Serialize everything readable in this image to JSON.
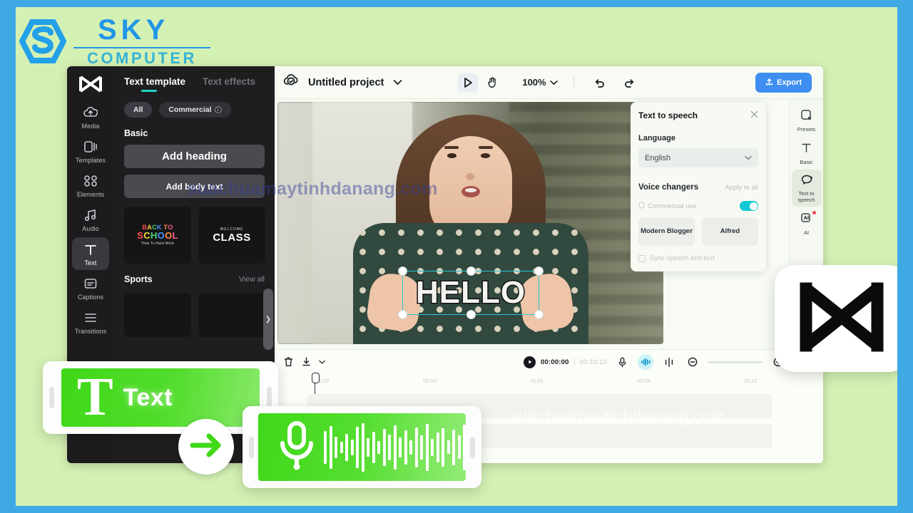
{
  "brand": {
    "name_top": "SKY",
    "name_bottom": "COMPUTER",
    "logo_icon": "sky-hexagon-s-logo"
  },
  "watermarks": {
    "top": "suachuamaytinhdanang.com",
    "timeline": "suachuamaytinhdanang.com"
  },
  "rail": {
    "app_logo_icon": "capcut-logo-icon",
    "items": [
      {
        "label": "Media",
        "icon": "cloud-upload-icon",
        "active": false
      },
      {
        "label": "Templates",
        "icon": "templates-icon",
        "active": false
      },
      {
        "label": "Elements",
        "icon": "elements-icon",
        "active": false
      },
      {
        "label": "Audio",
        "icon": "music-note-icon",
        "active": false
      },
      {
        "label": "Text",
        "icon": "text-t-icon",
        "active": true
      },
      {
        "label": "Captions",
        "icon": "captions-icon",
        "active": false
      },
      {
        "label": "Transitions",
        "icon": "transitions-icon",
        "active": false
      }
    ]
  },
  "panel": {
    "tabs": [
      {
        "label": "Text template",
        "active": true
      },
      {
        "label": "Text effects",
        "active": false
      }
    ],
    "chips": [
      {
        "label": "All",
        "selected": true,
        "info": false
      },
      {
        "label": "Commercial",
        "selected": false,
        "info": true,
        "info_glyph": "i"
      }
    ],
    "sections": [
      {
        "title": "Basic",
        "view_all": ""
      },
      {
        "title": "Sports",
        "view_all": "View all"
      }
    ],
    "buttons": [
      {
        "label": "Add heading"
      },
      {
        "label": "Add body text"
      }
    ],
    "thumbnails": [
      {
        "line1": "BACK TO",
        "line2": "SCHOOL",
        "line3": "Time To Hard Work"
      },
      {
        "small": "WELCOME",
        "big": "CLASS"
      }
    ],
    "scroll_arrow_icon": "chevron-right-icon"
  },
  "topbar": {
    "cloud_icon": "cloud-check-icon",
    "project_name": "Untitled project",
    "project_caret_icon": "chevron-down-icon",
    "tools": [
      {
        "icon": "select-arrow-icon",
        "active": true
      },
      {
        "icon": "hand-pan-icon",
        "active": false
      }
    ],
    "zoom_level": "100%",
    "zoom_caret_icon": "chevron-down-icon",
    "undo_icon": "undo-icon",
    "redo_icon": "redo-icon",
    "export_label": "Export",
    "export_icon": "export-upload-icon",
    "export_color": "#3d8ef0"
  },
  "canvas": {
    "overlay_text": "HELLO",
    "selection_handles": 6,
    "selection_color": "#27c4d2"
  },
  "tts": {
    "title": "Text to speech",
    "close_icon": "close-icon",
    "language_label": "Language",
    "language_value": "English",
    "language_caret_icon": "chevron-down-icon",
    "voice_changers_label": "Voice changers",
    "apply_to_all_label": "Apply to all",
    "commercial_use_label": "Commercial use",
    "commercial_use_icon": "shield-info-icon",
    "commercial_use_on": true,
    "toggle_color": "#13c9d6",
    "voices": [
      {
        "label": "Modern Blogger"
      },
      {
        "label": "Alfred"
      }
    ],
    "sync_label": "Sync speech and text",
    "sync_checked": false
  },
  "proprail": {
    "items": [
      {
        "label": "Presets",
        "icon": "presets-icon",
        "active": false,
        "badge": false
      },
      {
        "label": "Basic",
        "icon": "text-t-icon",
        "active": false,
        "badge": false
      },
      {
        "label": "Text to speech",
        "icon": "speech-bubble-icon",
        "active": true,
        "badge": false
      },
      {
        "label": "AI",
        "icon": "ai-sparkle-icon",
        "active": false,
        "badge": true
      }
    ]
  },
  "timeline": {
    "delete_icon": "trash-icon",
    "download_icon": "download-icon",
    "download_caret_icon": "chevron-down-icon",
    "play_icon": "play-icon",
    "current_time": "00:00:00",
    "total_time": "00:10:10",
    "right_tools": [
      {
        "icon": "microphone-icon",
        "highlighted": false
      },
      {
        "icon": "waveform-icon",
        "highlighted": true
      },
      {
        "icon": "split-icon",
        "highlighted": false
      },
      {
        "icon": "zoom-out-icon",
        "highlighted": false
      }
    ],
    "zoom_in_icon": "zoom-in-icon",
    "fit_icon": "fit-screen-icon",
    "more_icon": "chevron-down-icon",
    "ruler_ticks": [
      "00:00",
      "00:03",
      "00:06",
      "00:09",
      "00:12"
    ]
  },
  "cards": {
    "text_card": {
      "label": "Text",
      "glyph": "T"
    },
    "audio_card": {
      "icon": "microphone-icon"
    },
    "arrow_card": {
      "icon": "arrow-right-icon",
      "color": "#3fd818"
    },
    "capcut_card": {
      "icon": "capcut-logo-icon"
    }
  },
  "colors": {
    "page_border": "#3fa9e4",
    "stage_background": "#d4f1b4",
    "brand_blue": "#2196e8",
    "brand_teal": "#37b3d4",
    "accent_green": "#3fd818",
    "panel_dark": "#1e1e20"
  }
}
